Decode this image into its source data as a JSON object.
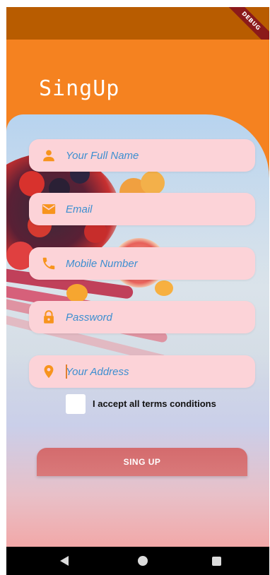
{
  "status_bar": {
    "debug_banner": "DEBUG"
  },
  "app_bar": {
    "title": "SingUp"
  },
  "form": {
    "fields": [
      {
        "name": "full-name",
        "icon": "person-icon",
        "placeholder": "Your Full Name",
        "value": ""
      },
      {
        "name": "email",
        "icon": "email-icon",
        "placeholder": "Email",
        "value": ""
      },
      {
        "name": "mobile",
        "icon": "phone-icon",
        "placeholder": "Mobile Number",
        "value": ""
      },
      {
        "name": "password",
        "icon": "lock-icon",
        "placeholder": "Password",
        "value": ""
      },
      {
        "name": "address",
        "icon": "location-pin-icon",
        "placeholder": "Your Address",
        "value": ""
      }
    ],
    "terms_label": "I accept all terms conditions",
    "terms_checked": false,
    "submit_label": "SING UP"
  },
  "nav_bar": {
    "items": [
      "back-icon",
      "home-icon",
      "recents-icon"
    ]
  },
  "colors": {
    "app_bar": "#f58220",
    "status_bar": "#b85c00",
    "field_bg": "#fcd3d8",
    "icon_accent": "#f7941d",
    "placeholder": "#3d8fd0",
    "button": "#d46b6d"
  }
}
